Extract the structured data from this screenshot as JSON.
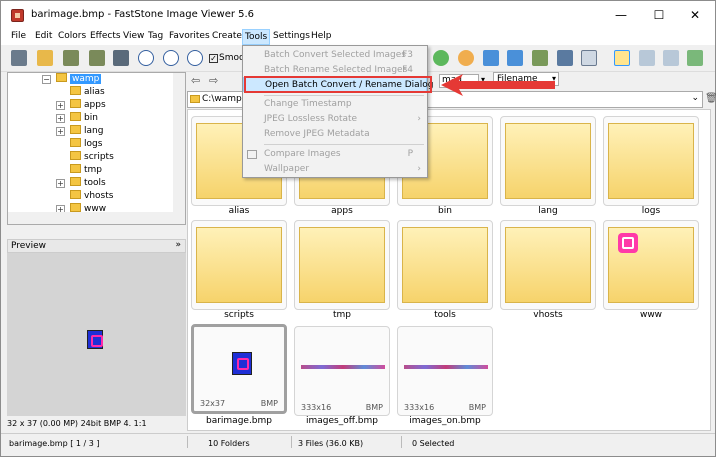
{
  "window": {
    "title": "barimage.bmp  -  FastStone Image Viewer 5.6",
    "minimize": "—",
    "maximize": "☐",
    "close": "✕"
  },
  "menubar": [
    "File",
    "Edit",
    "Colors",
    "Effects",
    "View",
    "Tag",
    "Favorites",
    "Create",
    "Tools",
    "Settings",
    "Help"
  ],
  "toolbar": {
    "smooth_label": "Smoo"
  },
  "tree": {
    "selected": "wamp",
    "items": [
      "alias",
      "apps",
      "bin",
      "lang",
      "logs",
      "scripts",
      "tmp",
      "tools",
      "vhosts",
      "www"
    ]
  },
  "preview": {
    "label": "Preview",
    "collapse_icon": "»"
  },
  "info_bar": "32 x 37 (0.00 MP)  24bit  BMP  4.  1:1",
  "nav": {
    "path": "C:\\wamp",
    "sort": "Filename",
    "sort_prefix": "mag"
  },
  "gallery": {
    "folders_row1": [
      "alias",
      "apps",
      "bin",
      "lang",
      "logs"
    ],
    "folders_row2": [
      "scripts",
      "tmp",
      "tools",
      "vhosts",
      "www"
    ],
    "files": [
      {
        "name": "barimage.bmp",
        "dims": "32x37",
        "fmt": "BMP"
      },
      {
        "name": "images_off.bmp",
        "dims": "333x16",
        "fmt": "BMP"
      },
      {
        "name": "images_on.bmp",
        "dims": "333x16",
        "fmt": "BMP"
      }
    ]
  },
  "status": {
    "file": "barimage.bmp [ 1 / 3 ]",
    "folders": "10 Folders",
    "files": "3 Files (36.0 KB)",
    "selected": "0 Selected"
  },
  "tools_menu": {
    "items": [
      {
        "label": "Batch Convert Selected Images",
        "shortcut": "F3",
        "state": "disabled"
      },
      {
        "label": "Batch Rename Selected Images",
        "shortcut": "F4",
        "state": "disabled"
      },
      {
        "label": "Open Batch Convert / Rename Dialog",
        "shortcut": "",
        "state": "highlighted"
      },
      {
        "label": "Change Timestamp",
        "shortcut": "",
        "state": "disabled"
      },
      {
        "label": "JPEG Lossless Rotate",
        "shortcut": "",
        "state": "disabled",
        "submenu": "›"
      },
      {
        "label": "Remove JPEG Metadata",
        "shortcut": "",
        "state": "disabled"
      },
      {
        "label": "Compare Images",
        "shortcut": "P",
        "state": "disabled"
      },
      {
        "label": "Wallpaper",
        "shortcut": "",
        "state": "disabled",
        "submenu": "›"
      }
    ]
  },
  "colors": {
    "highlight": "#cce8ff",
    "annotation": "#e53935",
    "folder": "#f4c542",
    "tree_selection": "#3399ff"
  }
}
